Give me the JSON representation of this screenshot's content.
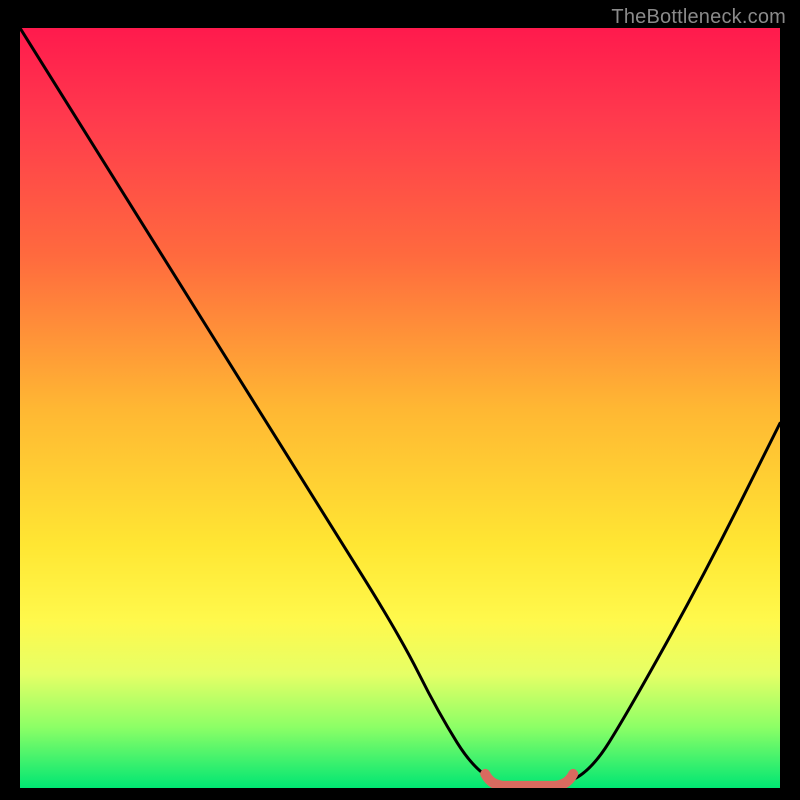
{
  "watermark": "TheBottleneck.com",
  "chart_data": {
    "type": "line",
    "title": "",
    "xlabel": "",
    "ylabel": "",
    "xlim": [
      0,
      100
    ],
    "ylim": [
      0,
      100
    ],
    "x": [
      0,
      10,
      20,
      30,
      40,
      50,
      55,
      60,
      65,
      70,
      75,
      80,
      90,
      100
    ],
    "bottleneck_pct": [
      100,
      84,
      68,
      52,
      36,
      20,
      10,
      2,
      0,
      0,
      2,
      10,
      28,
      48
    ],
    "optimal_range_x": [
      62,
      72
    ],
    "marker_color": "#d96a5f",
    "curve_color": "#000000",
    "background_gradient": [
      {
        "stop": 0.0,
        "color": "#ff1a4d"
      },
      {
        "stop": 0.5,
        "color": "#ffb733"
      },
      {
        "stop": 0.8,
        "color": "#fff94c"
      },
      {
        "stop": 1.0,
        "color": "#00e673"
      }
    ]
  }
}
